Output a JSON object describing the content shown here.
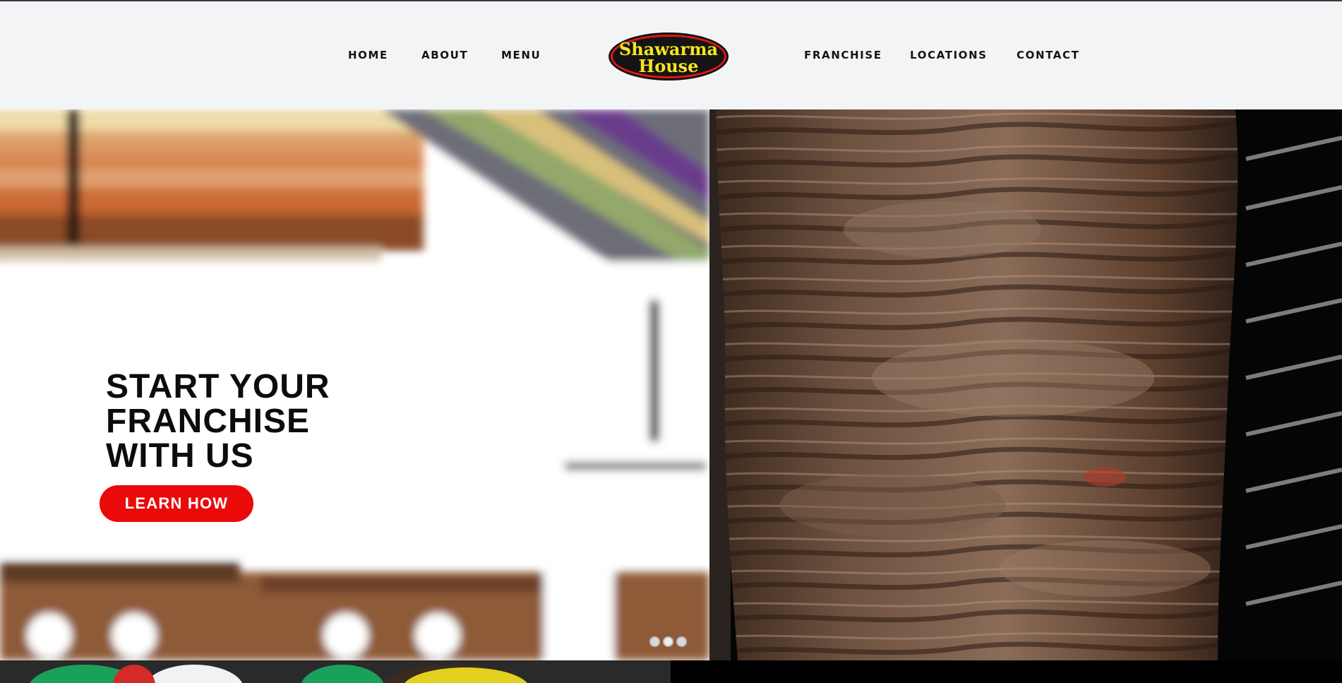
{
  "nav": {
    "left": [
      "HOME",
      "ABOUT",
      "MENU"
    ],
    "right": [
      "FRANCHISE",
      "LOCATIONS",
      "CONTACT"
    ]
  },
  "logo": {
    "line1": "Shawarma",
    "line2": "House"
  },
  "hero": {
    "title_lines": [
      "START YOUR",
      "FRANCHISE",
      "WITH US"
    ],
    "cta_label": "LEARN HOW",
    "slides": 3,
    "active_slide": 1
  },
  "colors": {
    "header_bg": "#f3f4f6",
    "cta": "#ea0a0a",
    "logo_yellow": "#f6e51f",
    "logo_red": "#d11414"
  },
  "icons": [
    "shawarma-house-logo",
    "carousel-dot"
  ]
}
